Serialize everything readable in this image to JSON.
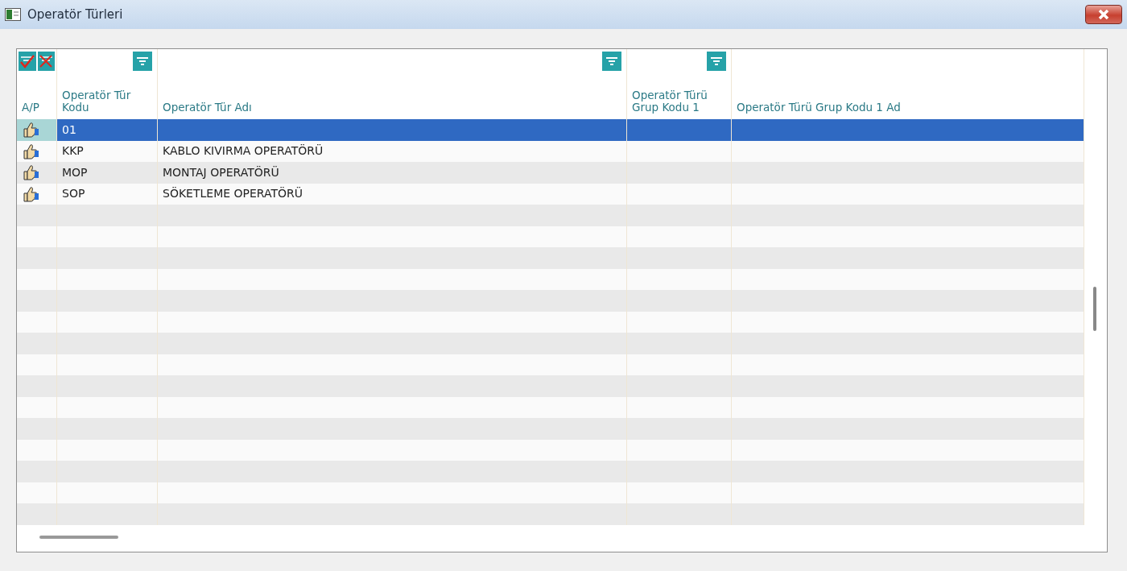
{
  "window": {
    "title": "Operatör Türleri"
  },
  "toolbar": {
    "select_all": true,
    "deselect_all": true
  },
  "columns": [
    {
      "label": "A/P",
      "filter": false
    },
    {
      "label": "Operatör Tür Kodu",
      "filter": true
    },
    {
      "label": "Operatör Tür Adı",
      "filter": true
    },
    {
      "label": "Operatör Türü Grup Kodu 1",
      "filter": true
    },
    {
      "label": "Operatör Türü Grup Kodu 1 Ad",
      "filter": false
    }
  ],
  "rows": [
    {
      "active": true,
      "code": "01",
      "name": "",
      "selected": true
    },
    {
      "active": true,
      "code": "KKP",
      "name": "KABLO KIVIRMA OPERATÖRÜ",
      "selected": false
    },
    {
      "active": true,
      "code": "MOP",
      "name": "MONTAJ OPERATÖRÜ",
      "selected": false
    },
    {
      "active": true,
      "code": "SOP",
      "name": "SÖKETLEME OPERATÖRÜ",
      "selected": false
    }
  ]
}
